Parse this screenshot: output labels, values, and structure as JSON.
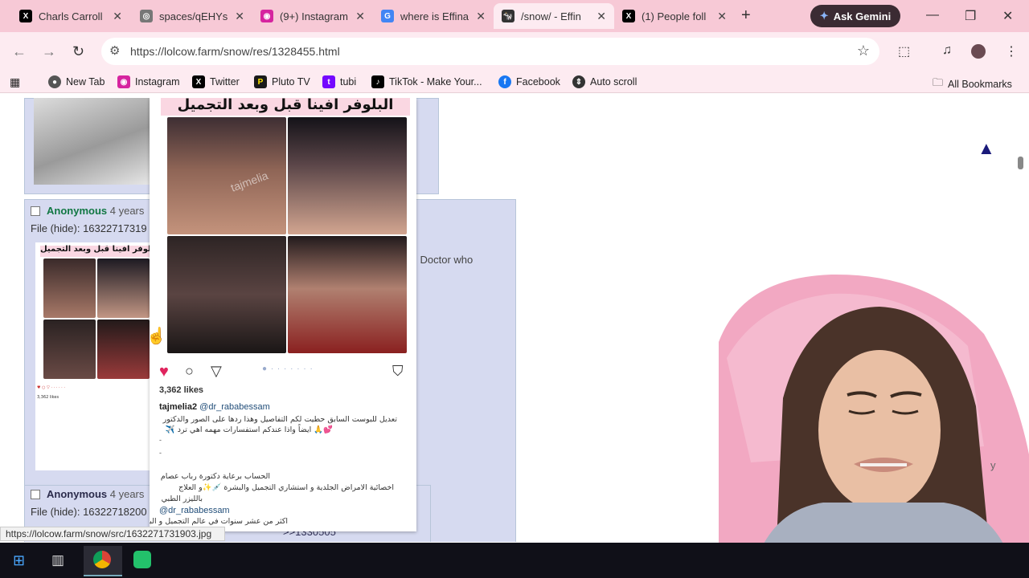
{
  "tabs": [
    {
      "title": "Charls Carroll",
      "icon": "x-icon",
      "color": "#000000"
    },
    {
      "title": "spaces/qEHYs",
      "icon": "globe-icon",
      "color": "#555555"
    },
    {
      "title": "(9+) Instagram",
      "icon": "instagram-icon",
      "color": "#d6249f"
    },
    {
      "title": "where is Effina",
      "icon": "google-icon",
      "color": "#4285f4"
    },
    {
      "title": "/snow/ - Effin",
      "icon": "lolcow-icon",
      "color": "#333333",
      "active": true
    },
    {
      "title": "(1) People foll",
      "icon": "x-icon",
      "color": "#000000"
    }
  ],
  "gemini_label": "Ask Gemini",
  "url": "https://lolcow.farm/snow/res/1328455.html",
  "bookmarks": [
    {
      "label": "New Tab",
      "icon": "chrome-icon",
      "color": "#555555"
    },
    {
      "label": "Instagram",
      "icon": "instagram-icon",
      "color": "#d6249f"
    },
    {
      "label": "Twitter",
      "icon": "x-icon",
      "color": "#000000"
    },
    {
      "label": "Pluto TV",
      "icon": "pluto-icon",
      "color": "#1a1a1a"
    },
    {
      "label": "tubi",
      "icon": "tubi-icon",
      "color": "#7408ff"
    },
    {
      "label": "TikTok - Make Your...",
      "icon": "tiktok-icon",
      "color": "#000000"
    },
    {
      "label": "Facebook",
      "icon": "facebook-icon",
      "color": "#1877f2"
    },
    {
      "label": "Auto scroll",
      "icon": "autoscroll-icon",
      "color": "#333333"
    }
  ],
  "all_bookmarks": "All Bookmarks",
  "posts": [
    {
      "name": "Anonymous",
      "age": "4 years",
      "file_label": "File",
      "hide": "(hide):",
      "file_name": "16322717319"
    },
    {
      "name": "Anonymous",
      "age": "4 years",
      "file_label": "File",
      "hide": "(hide):",
      "file_name": "16322718200"
    }
  ],
  "doctor_text": "l Doctor who",
  "reply_link": ">>1330505",
  "stray_char": "y",
  "hover": {
    "title_ar": "البلوفر افينا قبل وبعد التجميل",
    "watermark": "tajmelia",
    "likes": "3,362 likes",
    "username": "tajmelia2",
    "mention": "@dr_rababessam",
    "caption_line1": "تعديل للبوست السابق حطيت لكم التفاصيل وهذا ردها على الصور والدكتور",
    "caption_line2": "💕🙏 ايضاً واذا عندكم استفسارات مهمه اهي ترد ✈️",
    "dash": "-",
    "account_line": "الحساب برعاية دكتورة رباب عصام",
    "specialty_line": "اخصائية الامراض الجلدية و استشاري التجميل والبشرة 💉✨و العلاج",
    "laser_line": "بالليزر الطبي",
    "doctor_handle": "@dr_rababessam",
    "experience_line": "اكثر من عشر سنوات في عالم التجميل و البشرة"
  },
  "status_url": "https://lolcow.farm/snow/src/1632271731903.jpg"
}
